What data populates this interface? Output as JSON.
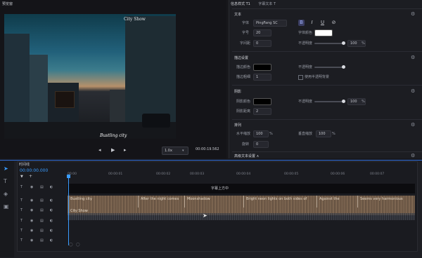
{
  "preview": {
    "title": "预览窗",
    "watermark": "City Show",
    "subtitle": "Bustling city",
    "speed": "1.0x",
    "time": "00:00:19.562",
    "controls": [
      "◂",
      "▶",
      "▸"
    ]
  },
  "props": {
    "tabs": [
      "信息样式 T1",
      "字幕文本 T"
    ],
    "text_section": {
      "title": "文本",
      "font_label": "字体",
      "font_value": "PingFang SC",
      "size_label": "字号",
      "size_value": "20",
      "spacing_label": "字间距",
      "spacing_value": "0",
      "color_label": "字体颜色",
      "color_value": "#ffffff",
      "opacity_label": "不透明度",
      "opacity_value": "100",
      "opacity_unit": "%"
    },
    "stroke_section": {
      "title": "描边设置",
      "color_label": "描边颜色",
      "color_value": "#000000",
      "width_label": "描边粗细",
      "width_value": "1",
      "opacity_label": "不透明度",
      "checkbox_label": "使用半透明背景"
    },
    "shadow_section": {
      "title": "阴影",
      "color_label": "阴影颜色",
      "distance_label": "阴影距离",
      "distance_value": "2",
      "opacity_label": "不透明度",
      "opacity_value": "100",
      "opacity_unit": "%"
    },
    "layout_section": {
      "title": "排列",
      "h_label": "水平缩放",
      "h_value": "100",
      "h_unit": "%",
      "v_label": "垂直缩放",
      "v_value": "100",
      "v_unit": "%",
      "rotate_label": "旋转",
      "rotate_value": "0"
    },
    "more_section": {
      "title": "高级文本设置 ∧"
    }
  },
  "timeline": {
    "title": "时间线",
    "time": "00:00:00.000",
    "ruler": [
      "00:00",
      "00:00:01",
      "00:00:02",
      "00:00:03",
      "00:00:04",
      "00:00:05",
      "00:00:06",
      "00:00:07"
    ],
    "caption": "字幕上方中",
    "clips": [
      "Bustling city",
      "After the night comes",
      "Moonshadow",
      "Bright neon lights on both sides of",
      "Against the",
      "Seems very harmonious"
    ],
    "audio_label": "City Show",
    "track_tags": [
      "T",
      "T",
      "T",
      "T",
      "T",
      "T"
    ]
  },
  "colors": {
    "accent": "#3a9cff",
    "panel": "#1c1d22",
    "audio": "#8a6f55"
  }
}
